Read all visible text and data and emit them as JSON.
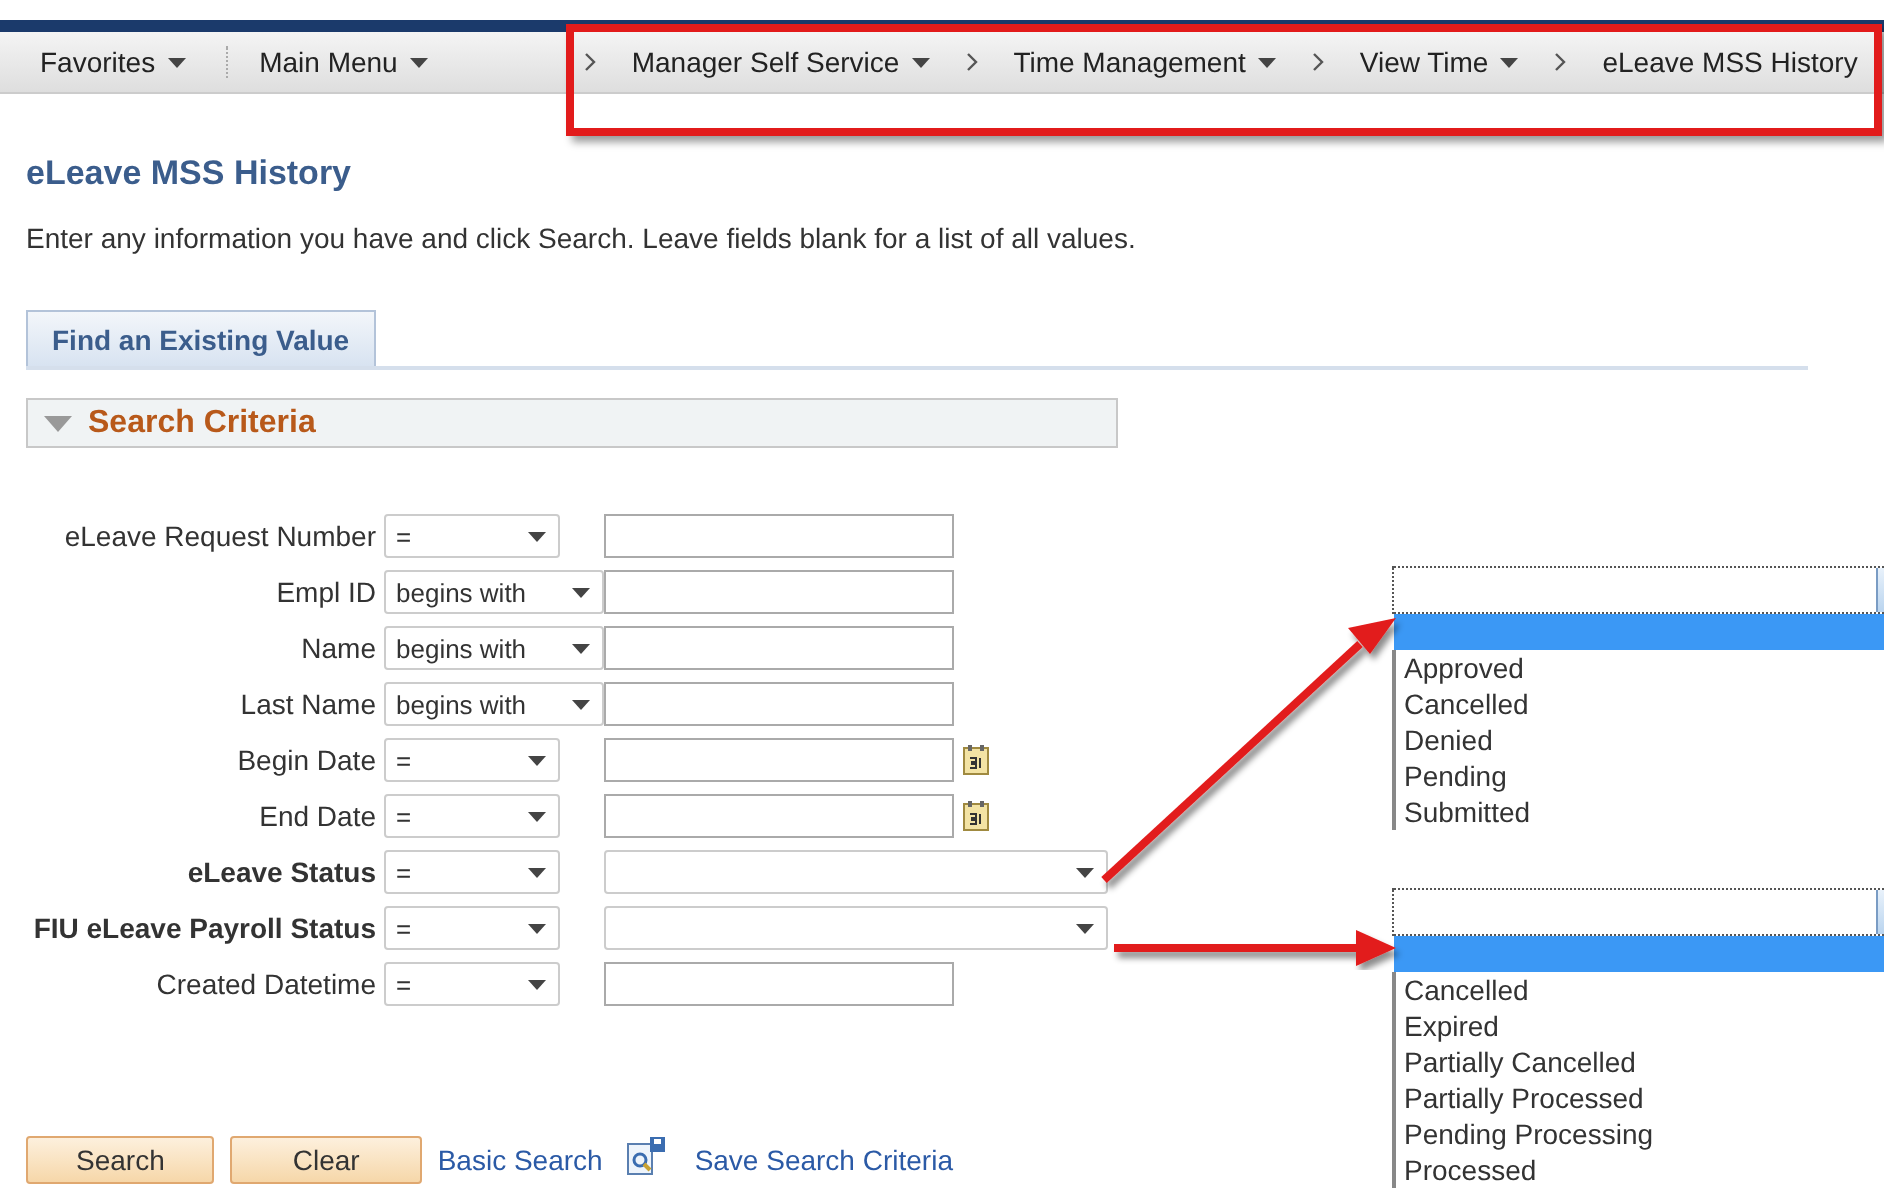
{
  "nav": [
    {
      "label": "Favorites",
      "menu": true
    },
    {
      "label": "Main Menu",
      "menu": true
    },
    {
      "label": "Manager Self Service",
      "menu": true
    },
    {
      "label": "Time Management",
      "menu": true
    },
    {
      "label": "View Time",
      "menu": true
    },
    {
      "label": "eLeave MSS History",
      "menu": false
    }
  ],
  "page_title": "eLeave MSS History",
  "instructions": "Enter any information you have and click Search. Leave fields blank for a list of all values.",
  "tabs": [
    {
      "label": "Find an Existing Value",
      "selected": true
    }
  ],
  "section": {
    "title": "Search Criteria",
    "expanded": true
  },
  "criteria": [
    {
      "label": "eLeave Request Number",
      "bold": false,
      "operator": "=",
      "kind": "text"
    },
    {
      "label": "Empl ID",
      "bold": false,
      "operator": "begins with",
      "kind": "text"
    },
    {
      "label": "Name",
      "bold": false,
      "operator": "begins with",
      "kind": "text"
    },
    {
      "label": "Last Name",
      "bold": false,
      "operator": "begins with",
      "kind": "text"
    },
    {
      "label": "Begin Date",
      "bold": false,
      "operator": "=",
      "kind": "date"
    },
    {
      "label": "End Date",
      "bold": false,
      "operator": "=",
      "kind": "date"
    },
    {
      "label": "eLeave Status",
      "bold": true,
      "operator": "=",
      "kind": "select"
    },
    {
      "label": "FIU eLeave Payroll Status",
      "bold": true,
      "operator": "=",
      "kind": "select"
    },
    {
      "label": "Created Datetime",
      "bold": false,
      "operator": "=",
      "kind": "text"
    }
  ],
  "buttons": [
    "Search",
    "Clear"
  ],
  "links": [
    "Basic Search",
    "Save Search Criteria"
  ],
  "dropdown_popups": [
    {
      "options": [
        "Approved",
        "Cancelled",
        "Denied",
        "Pending",
        "Submitted"
      ]
    },
    {
      "options": [
        "Cancelled",
        "Expired",
        "Partially Cancelled",
        "Partially Processed",
        "Pending Processing",
        "Processed"
      ]
    }
  ]
}
